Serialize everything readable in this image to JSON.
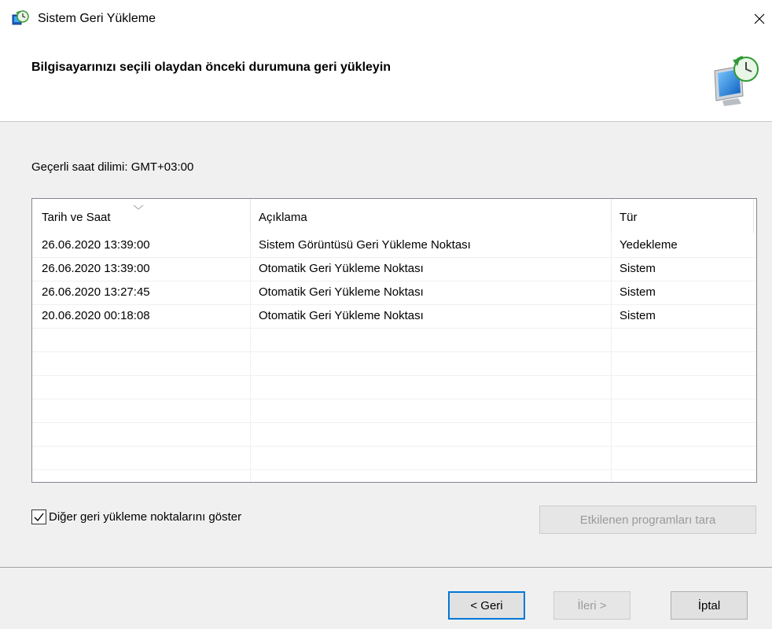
{
  "window": {
    "title": "Sistem Geri Yükleme",
    "app_icon": "system-restore-icon",
    "close_icon": "close-icon"
  },
  "header": {
    "title": "Bilgisayarınızı seçili olaydan önceki durumuna geri yükleyin",
    "icon": "system-restore-monitor-icon"
  },
  "timezone_label": "Geçerli saat dilimi: GMT+03:00",
  "restore_points": {
    "columns": [
      "Tarih ve Saat",
      "Açıklama",
      "Tür"
    ],
    "sorted_column": "Tarih ve Saat",
    "sort_direction": "descending",
    "rows": [
      [
        "26.06.2020 13:39:00",
        "Sistem Görüntüsü Geri Yükleme Noktası",
        "Yedekleme"
      ],
      [
        "26.06.2020 13:39:00",
        "Otomatik Geri Yükleme Noktası",
        "Sistem"
      ],
      [
        "26.06.2020 13:27:45",
        "Otomatik Geri Yükleme Noktası",
        "Sistem"
      ],
      [
        "20.06.2020 00:18:08",
        "Otomatik Geri Yükleme Noktası",
        "Sistem"
      ]
    ]
  },
  "show_more_checkbox": {
    "label": "Diğer geri yükleme noktalarını göster",
    "checked": true
  },
  "buttons": {
    "scan": "Etkilenen programları tara",
    "back": "< Geri",
    "next": "İleri >",
    "cancel": "İptal"
  },
  "colors": {
    "accent": "#0078d7",
    "background": "#f0f0f0",
    "disabled_text": "#9a9a9a"
  }
}
